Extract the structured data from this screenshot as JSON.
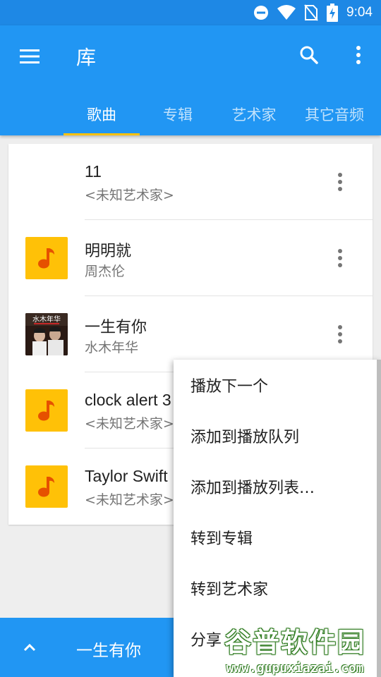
{
  "status_bar": {
    "time": "9:04",
    "icons": [
      "do-not-disturb-icon",
      "wifi-icon",
      "no-sim-icon",
      "battery-charging-icon"
    ]
  },
  "app_bar": {
    "title": "库",
    "menu_icon": "hamburger-menu-icon",
    "search_icon": "search-icon",
    "overflow_icon": "more-vert-icon",
    "accent": "#2196f3",
    "indicator_color": "#ffc107"
  },
  "tabs": [
    {
      "label": "歌曲",
      "active": true
    },
    {
      "label": "专辑",
      "active": false
    },
    {
      "label": "艺术家",
      "active": false
    },
    {
      "label": "其它音频",
      "active": false
    }
  ],
  "songs": [
    {
      "title": "11",
      "artist": "<未知艺术家>",
      "thumb": "none"
    },
    {
      "title": "明明就",
      "artist": "周杰伦",
      "thumb": "music-note-icon"
    },
    {
      "title": "一生有你",
      "artist": "水木年华",
      "thumb": "album-art",
      "art_text": "水木年华"
    },
    {
      "title": "clock alert 3",
      "artist": "<未知艺术家>",
      "thumb": "music-note-icon"
    },
    {
      "title": "Taylor Swift",
      "artist": "<未知艺术家>",
      "thumb": "music-note-icon"
    }
  ],
  "context_menu": {
    "items": [
      "播放下一个",
      "添加到播放队列",
      "添加到播放列表…",
      "转到专辑",
      "转到艺术家",
      "分享"
    ]
  },
  "mini_player": {
    "title": "一生有你",
    "icon": "chevron-up-icon"
  },
  "watermark": {
    "logo": "谷普软件园",
    "url": "www.gupuxiazai.com"
  },
  "colors": {
    "thumb_bg": "#ffc107",
    "note": "#e65100"
  }
}
